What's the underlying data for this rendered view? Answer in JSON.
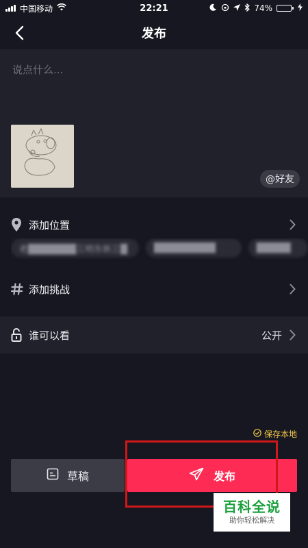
{
  "status_bar": {
    "carrier": "中国移动",
    "time": "22:21",
    "battery_percent_label": "74%",
    "battery_level": 0.74
  },
  "nav": {
    "title": "发布"
  },
  "caption": {
    "placeholder": "说点什么...",
    "value": ""
  },
  "mention_button": {
    "label": "@好友"
  },
  "location": {
    "label": "添加位置",
    "suggestions": [
      "老███████三明东新三█",
      "█████████",
      "█████"
    ]
  },
  "challenge": {
    "label": "添加挑战"
  },
  "visibility": {
    "label": "谁可以看",
    "value": "公开"
  },
  "save_local": {
    "label": "保存本地",
    "checked": true,
    "color": "#f4c74a"
  },
  "buttons": {
    "draft_label": "草稿",
    "publish_label": "发布",
    "publish_color": "#fe2c55"
  },
  "watermark": {
    "main": "百科全说",
    "sub": "助你轻松解决"
  },
  "icons": {
    "back": "chevron-left-icon",
    "location": "location-pin-icon",
    "challenge": "hashtag-icon",
    "visibility": "unlock-icon",
    "draft": "draft-box-icon",
    "publish": "paper-plane-icon"
  }
}
